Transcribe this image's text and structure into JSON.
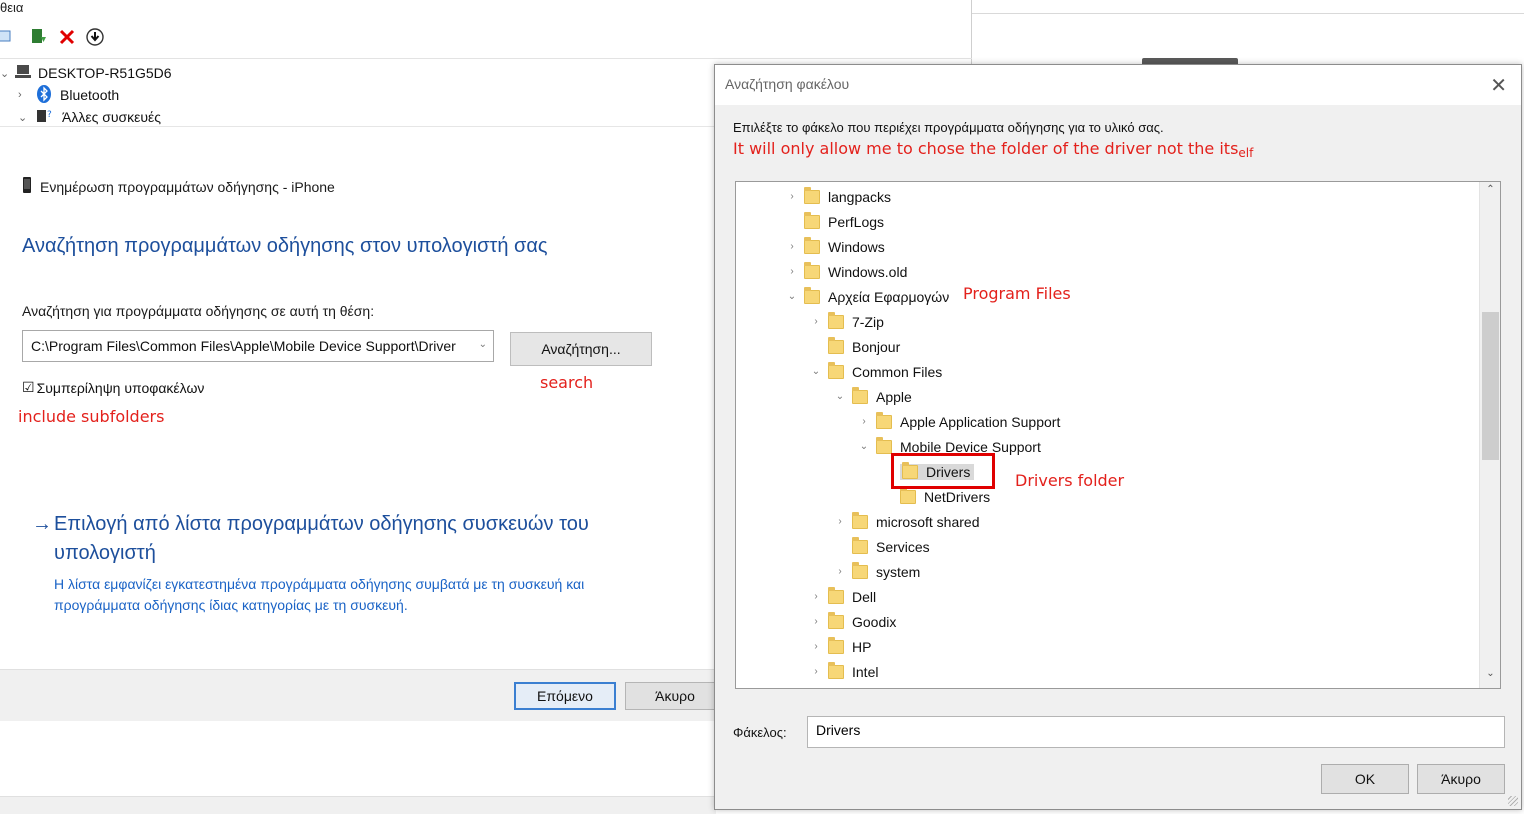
{
  "devmgr": {
    "menu_label": "θεια",
    "tree": {
      "root": "DESKTOP-R51G5D6",
      "item1": "Bluetooth",
      "item2": "Άλλες συσκευές"
    }
  },
  "wizard": {
    "header": "Ενημέρωση προγραμμάτων οδήγησης - iPhone",
    "title": "Αναζήτηση προγραμμάτων οδήγησης στον υπολογιστή σας",
    "search_label": "Αναζήτηση για προγράμματα οδήγησης σε αυτή τη θέση:",
    "path_value": "C:\\Program Files\\Common Files\\Apple\\Mobile Device Support\\Driver",
    "browse_button": "Αναζήτηση...",
    "include_subfolders": "Συμπερίληψη υποφακέλων",
    "note_search": "search",
    "note_include": "include subfolders",
    "pick_title": "Επιλογή από λίστα προγραμμάτων οδήγησης συσκευών του υπολογιστή",
    "pick_desc": "Η λίστα εμφανίζει εγκατεστημένα προγράμματα οδήγησης συμβατά με τη συσκευή και προγράμματα οδήγησης ίδιας κατηγορίας με τη συσκευή.",
    "next_button": "Επόμενο",
    "cancel_button": "Άκυρο"
  },
  "browse": {
    "title": "Αναζήτηση φακέλου",
    "instruction": "Επιλέξτε το φάκελο που περιέχει προγράμματα οδήγησης για το υλικό σας.",
    "note_top": "It will only allow me to chose the folder of the driver not the its",
    "note_top_small": "elf",
    "note_program_files": "Program Files",
    "note_drivers_folder": "Drivers folder",
    "tree": [
      {
        "label": "langpacks",
        "level": 0,
        "chevron": "›"
      },
      {
        "label": "PerfLogs",
        "level": 0,
        "chevron": ""
      },
      {
        "label": "Windows",
        "level": 0,
        "chevron": "›"
      },
      {
        "label": "Windows.old",
        "level": 0,
        "chevron": "›"
      },
      {
        "label": "Αρχεία Εφαρμογών",
        "level": 0,
        "chevron": "⌄"
      },
      {
        "label": "7-Zip",
        "level": 1,
        "chevron": "›"
      },
      {
        "label": "Bonjour",
        "level": 1,
        "chevron": ""
      },
      {
        "label": "Common Files",
        "level": 1,
        "chevron": "⌄"
      },
      {
        "label": "Apple",
        "level": 2,
        "chevron": "⌄"
      },
      {
        "label": "Apple Application Support",
        "level": 3,
        "chevron": "›"
      },
      {
        "label": "Mobile Device Support",
        "level": 3,
        "chevron": "⌄"
      },
      {
        "label": "Drivers",
        "level": 4,
        "chevron": "",
        "selected": true
      },
      {
        "label": "NetDrivers",
        "level": 4,
        "chevron": ""
      },
      {
        "label": "microsoft shared",
        "level": 2,
        "chevron": "›"
      },
      {
        "label": "Services",
        "level": 2,
        "chevron": ""
      },
      {
        "label": "system",
        "level": 2,
        "chevron": "›"
      },
      {
        "label": "Dell",
        "level": 1,
        "chevron": "›"
      },
      {
        "label": "Goodix",
        "level": 1,
        "chevron": "›"
      },
      {
        "label": "HP",
        "level": 1,
        "chevron": "›"
      },
      {
        "label": "Intel",
        "level": 1,
        "chevron": "›"
      }
    ],
    "folder_label": "Φάκελος:",
    "folder_value": "Drivers",
    "ok_button": "OK",
    "cancel_button": "Άκυρο"
  }
}
